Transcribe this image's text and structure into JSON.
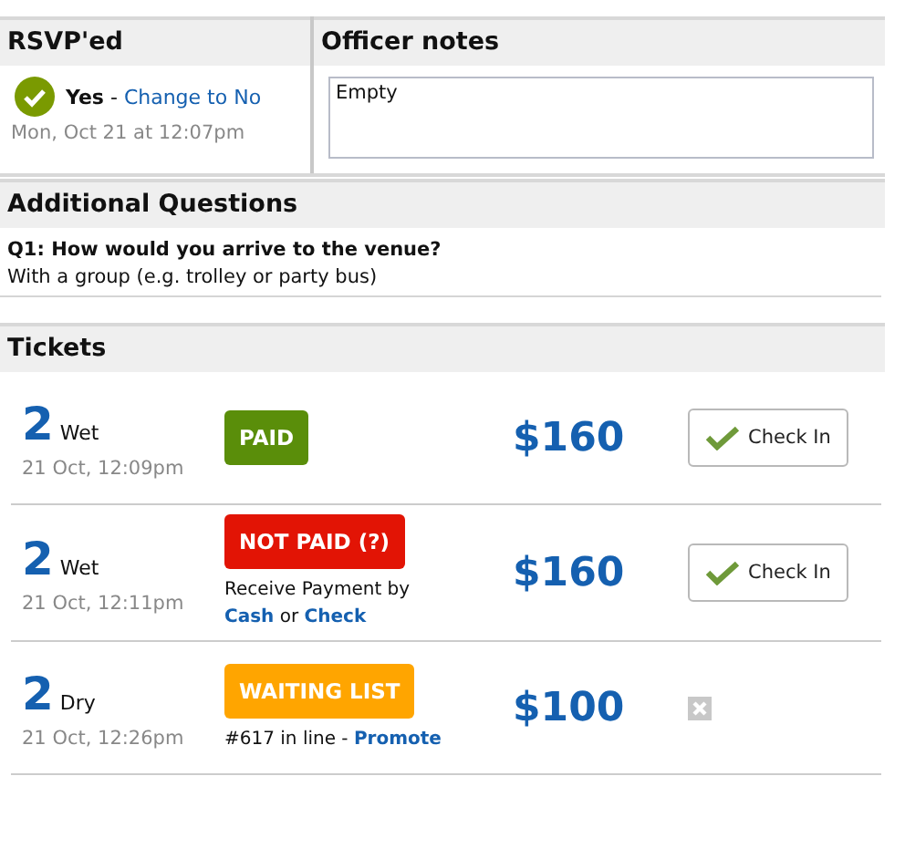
{
  "rsvp": {
    "title": "RSVP'ed",
    "answer": "Yes",
    "separator": "-",
    "change_link": "Change to No",
    "date": "Mon, Oct 21 at 12:07pm"
  },
  "officer_notes": {
    "title": "Officer notes",
    "value": "Empty"
  },
  "additional_questions": {
    "title": "Additional Questions",
    "items": [
      {
        "question": "Q1: How would you arrive to the venue?",
        "answer": "With a group (e.g. trolley or party bus)"
      }
    ]
  },
  "tickets": {
    "title": "Tickets",
    "rows": [
      {
        "quantity": "2",
        "type": "Wet",
        "time": "21 Oct, 12:09pm",
        "status": {
          "kind": "paid",
          "label": "PAID"
        },
        "note": [],
        "price": "$160",
        "action": {
          "kind": "check_in",
          "label": "Check In"
        }
      },
      {
        "quantity": "2",
        "type": "Wet",
        "time": "21 Oct, 12:11pm",
        "status": {
          "kind": "not_paid",
          "label": "NOT PAID (?)"
        },
        "note": [
          [
            {
              "text": "Receive Payment by",
              "link": false
            }
          ],
          [
            {
              "text": "Cash",
              "link": true
            },
            {
              "text": "or",
              "link": false
            },
            {
              "text": "Check",
              "link": true
            }
          ]
        ],
        "price": "$160",
        "action": {
          "kind": "check_in",
          "label": "Check In"
        }
      },
      {
        "quantity": "2",
        "type": "Dry",
        "time": "21 Oct, 12:26pm",
        "status": {
          "kind": "waiting",
          "label": "WAITING LIST"
        },
        "note": [
          [
            {
              "text": "#617 in line -",
              "link": false
            },
            {
              "text": "Promote",
              "link": true
            }
          ]
        ],
        "price": "$100",
        "action": {
          "kind": "remove"
        }
      }
    ]
  }
}
